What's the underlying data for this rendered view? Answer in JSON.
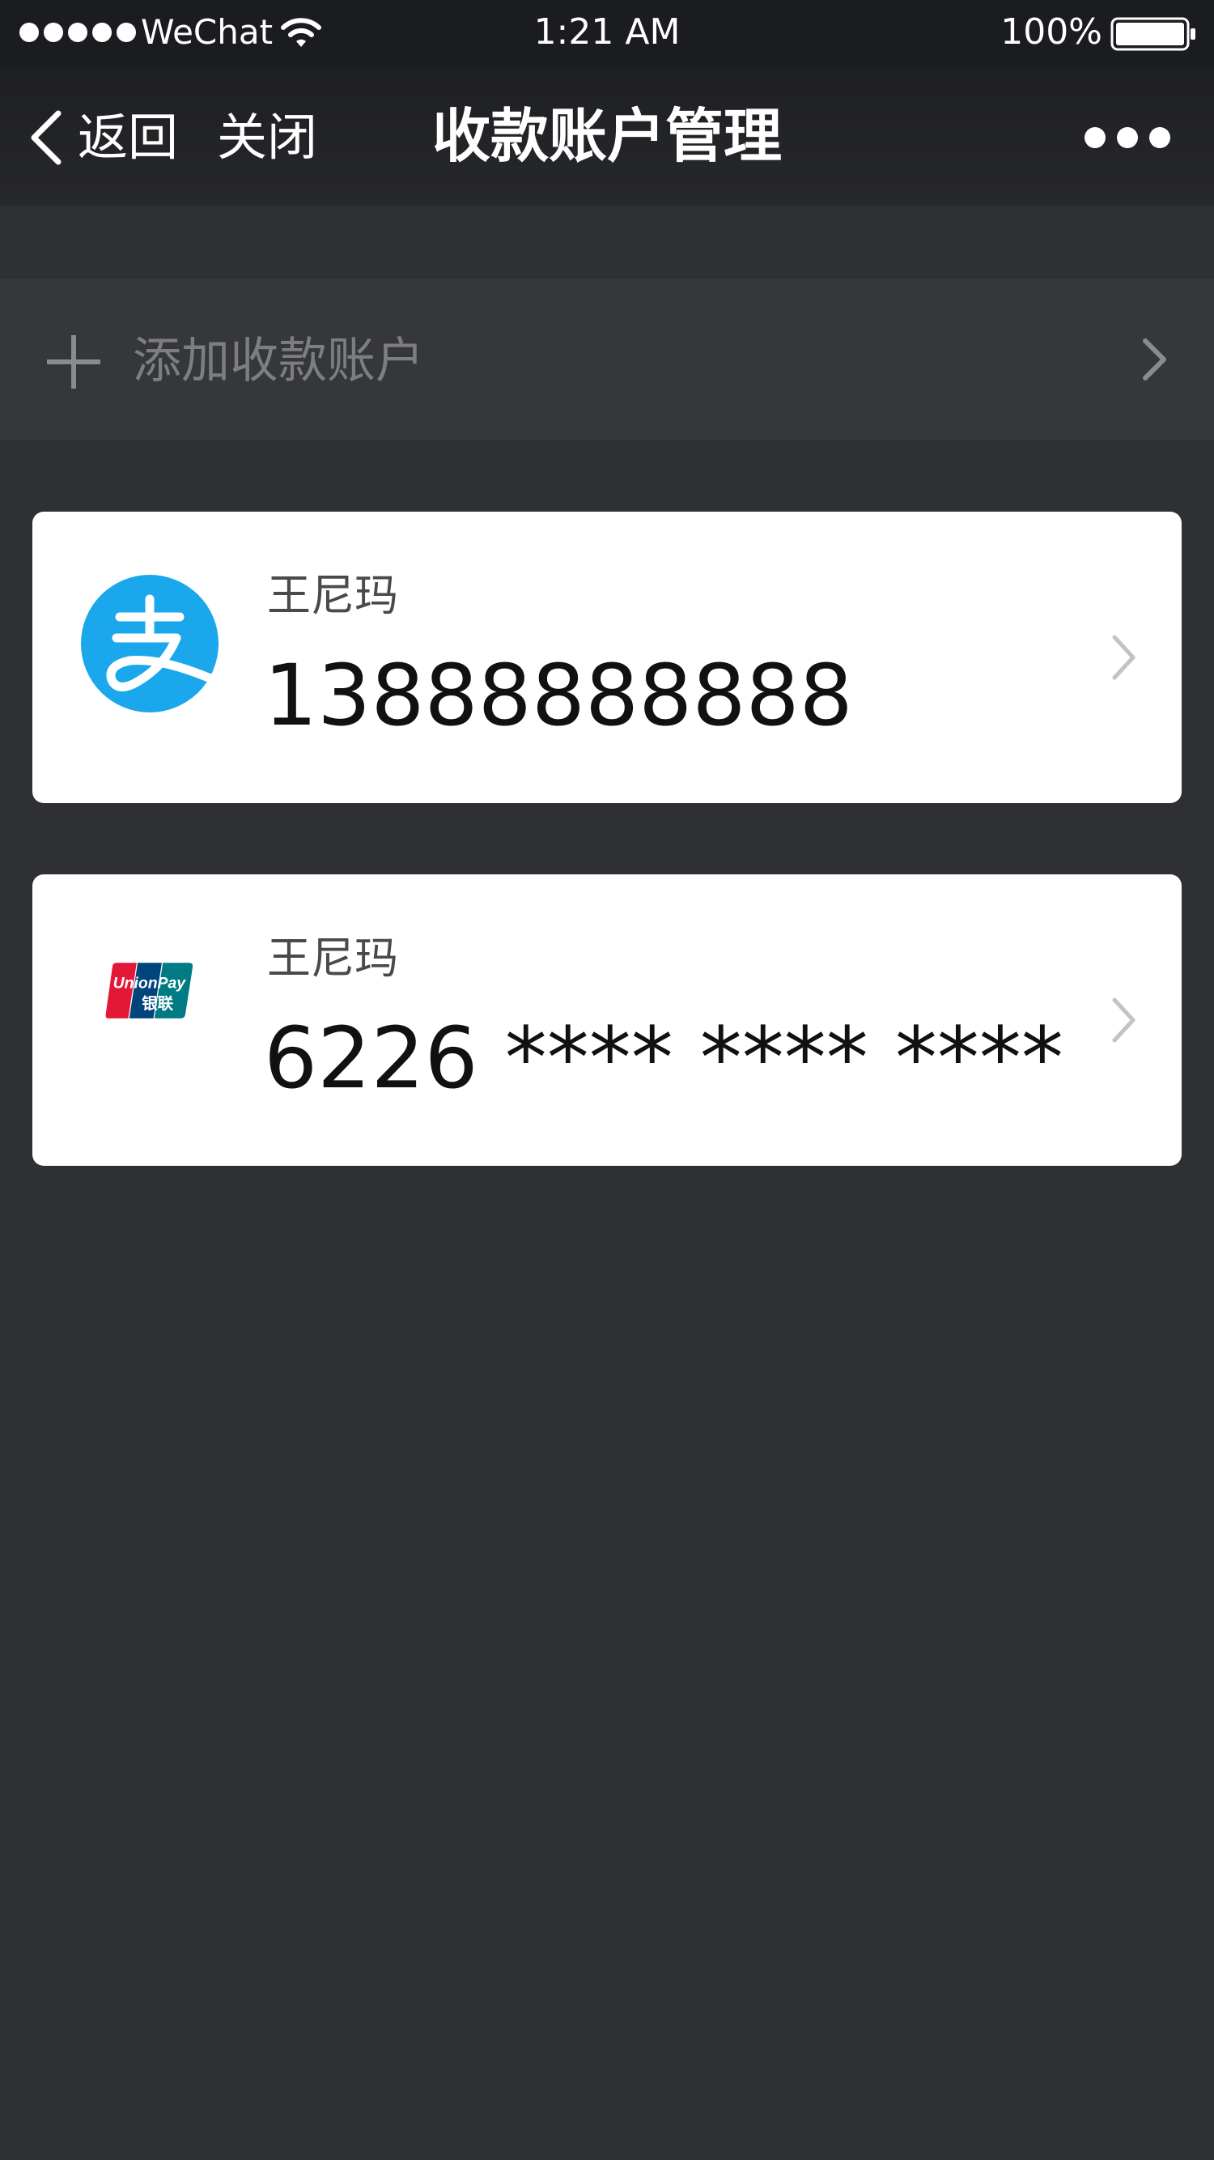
{
  "status_bar": {
    "carrier": "WeChat",
    "time": "1:21 AM",
    "battery": "100%",
    "signal_icon": "signal-dots-icon",
    "wifi_icon": "wifi-icon",
    "battery_icon": "battery-icon"
  },
  "nav": {
    "back_label": "返回",
    "close_label": "关闭",
    "title": "收款账户管理",
    "more_icon": "more-icon"
  },
  "add_account": {
    "label": "添加收款账户",
    "icon": "plus-icon"
  },
  "accounts": [
    {
      "type": "alipay",
      "logo_icon": "alipay-logo-icon",
      "logo_color": "#1aa7ec",
      "name": "王尼玛",
      "number": "13888888888"
    },
    {
      "type": "unionpay",
      "logo_icon": "unionpay-logo-icon",
      "logo_text": "UnionPay 银联",
      "name": "王尼玛",
      "number": "6226 **** **** ****"
    }
  ],
  "colors": {
    "background": "#2f3033",
    "nav_bar": "#1e1f22",
    "add_row": "#36373a",
    "card": "#ffffff",
    "alipay_blue": "#1aa7ec",
    "unionpay_red": "#e21836",
    "unionpay_blue": "#00447c",
    "unionpay_teal": "#007b84"
  }
}
